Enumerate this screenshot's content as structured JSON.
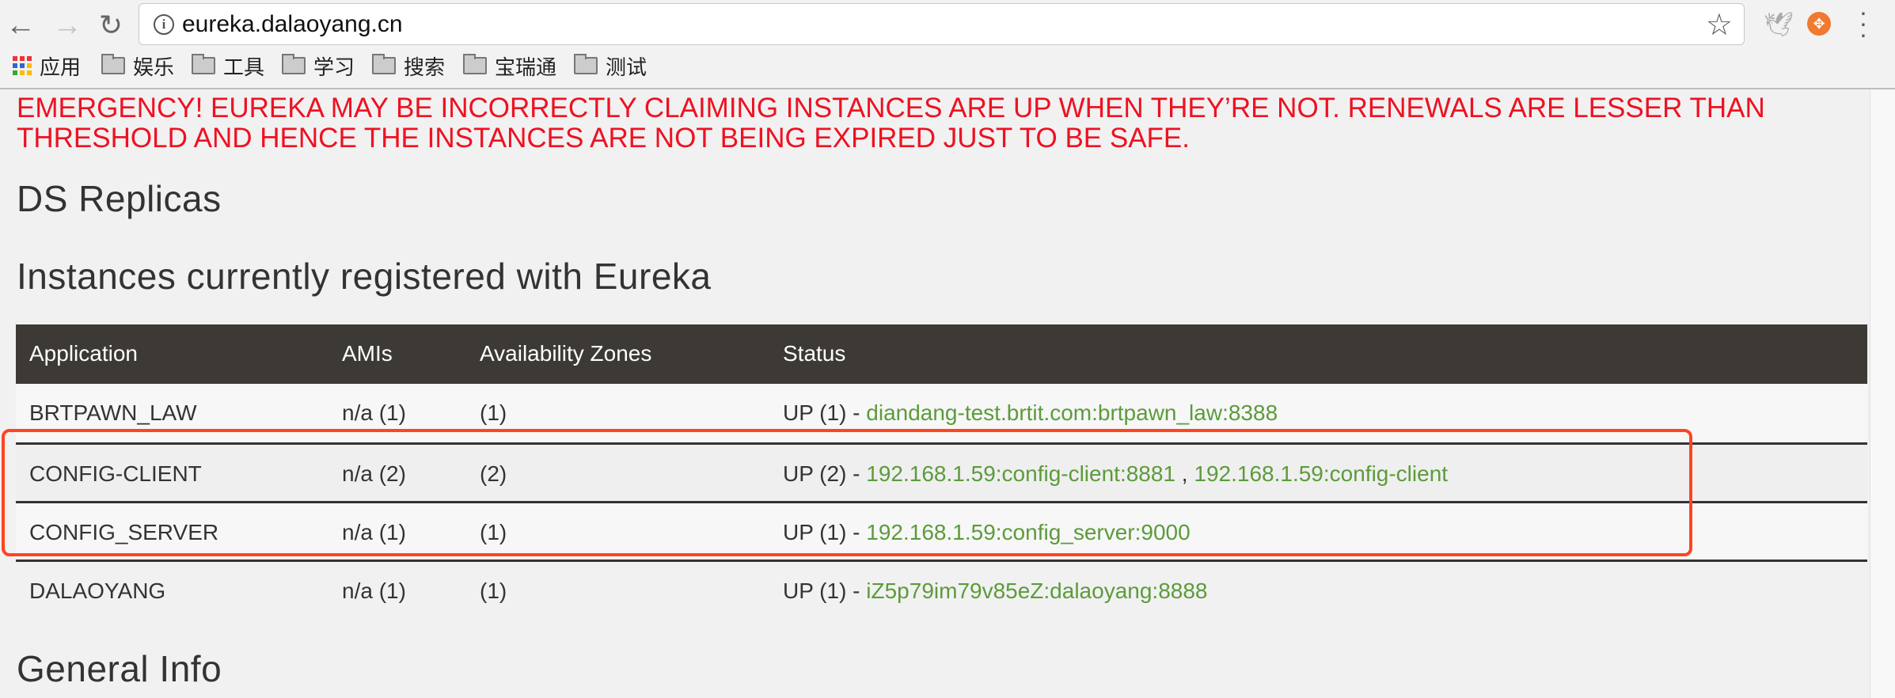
{
  "browser": {
    "url": "eureka.dalaoyang.cn",
    "bookmarks": [
      {
        "label": "应用",
        "icon": "apps-grid-icon"
      },
      {
        "label": "娱乐",
        "icon": "folder-icon"
      },
      {
        "label": "工具",
        "icon": "folder-icon"
      },
      {
        "label": "学习",
        "icon": "folder-icon"
      },
      {
        "label": "搜索",
        "icon": "folder-icon"
      },
      {
        "label": "宝瑞通",
        "icon": "folder-icon"
      },
      {
        "label": "测试",
        "icon": "folder-icon"
      }
    ]
  },
  "page": {
    "emergency": "EMERGENCY! EUREKA MAY BE INCORRECTLY CLAIMING INSTANCES ARE UP WHEN THEY’RE NOT. RENEWALS ARE LESSER THAN THRESHOLD AND HENCE THE INSTANCES ARE NOT BEING EXPIRED JUST TO BE SAFE.",
    "ds_replicas_title": "DS Replicas",
    "instances_title": "Instances currently registered with Eureka",
    "general_info_title": "General Info",
    "table": {
      "headers": [
        "Application",
        "AMIs",
        "Availability Zones",
        "Status"
      ],
      "rows": [
        {
          "app": "BRTPAWN_LAW",
          "amis": "n/a (1)",
          "zones": "(1)",
          "status": "UP (1) - ",
          "links": [
            "diandang-test.brtit.com:brtpawn_law:8388"
          ]
        },
        {
          "app": "CONFIG-CLIENT",
          "amis": "n/a (2)",
          "zones": "(2)",
          "status": "UP (2) - ",
          "links": [
            "192.168.1.59:config-client:8881",
            "192.168.1.59:config-client"
          ]
        },
        {
          "app": "CONFIG_SERVER",
          "amis": "n/a (1)",
          "zones": "(1)",
          "status": "UP (1) - ",
          "links": [
            "192.168.1.59:config_server:9000"
          ]
        },
        {
          "app": "DALAOYANG",
          "amis": "n/a (1)",
          "zones": "(1)",
          "status": "UP (1) - ",
          "links": [
            "iZ5p79im79v85eZ:dalaoyang:8888"
          ]
        }
      ],
      "link_separator": " , "
    }
  },
  "colors": {
    "emergency": "#ee1122",
    "link": "#5c9b3b",
    "header_bg": "#3d3935",
    "highlight": "#ff4422"
  }
}
